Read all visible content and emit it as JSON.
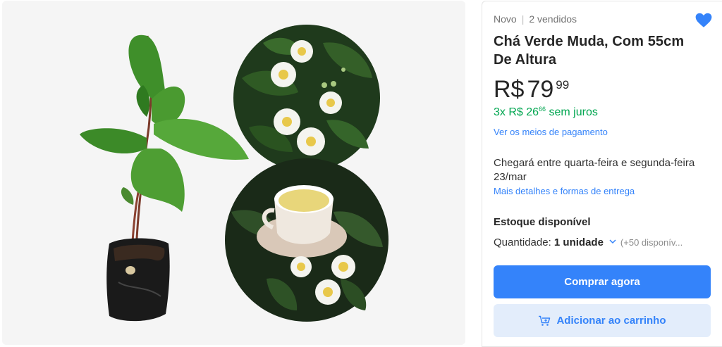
{
  "product": {
    "condition": "Novo",
    "separator": "|",
    "sold": "2 vendidos",
    "title": "Chá Verde Muda, Com 55cm De Altura",
    "favorite_icon": "heart-icon"
  },
  "price": {
    "currency": "R$",
    "integer": "79",
    "cents": "99"
  },
  "installments": {
    "prefix": "3x R$ 26",
    "cents": "66",
    "suffix": " sem juros"
  },
  "links": {
    "payment_methods": "Ver os meios de pagamento",
    "delivery_details": "Mais detalhes e formas de entrega"
  },
  "delivery": {
    "text": "Chegará entre quarta-feira e segunda-feira 23/mar"
  },
  "stock": {
    "heading": "Estoque disponível",
    "quantity_label": "Quantidade: ",
    "quantity_value": "1 unidade",
    "available": "(+50 disponív..."
  },
  "actions": {
    "buy_now": "Comprar agora",
    "add_to_cart": "Adicionar ao carrinho"
  },
  "colors": {
    "accent": "#3483fa",
    "installment_green": "#00a650",
    "cart_button_bg": "#e3edfb"
  }
}
